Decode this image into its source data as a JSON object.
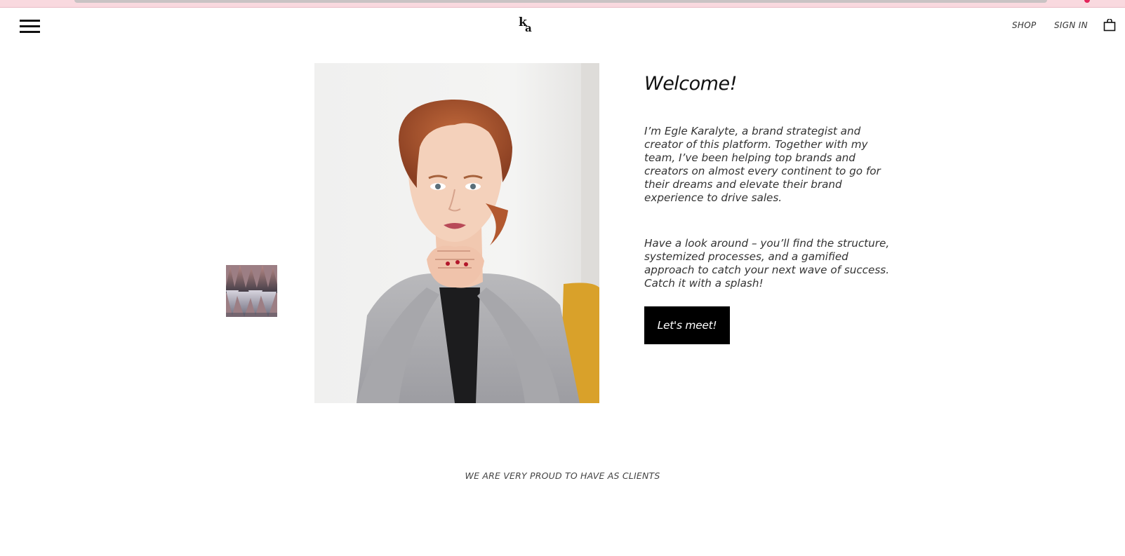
{
  "browser": {
    "accent_color": "#f9d9df"
  },
  "header": {
    "menu_icon": "hamburger-menu-icon",
    "logo_text": "ka",
    "nav": {
      "shop_label": "SHOP",
      "signin_label": "SIGN IN"
    },
    "cart_icon": "shopping-bag-icon"
  },
  "hero": {
    "thumbnail_icon": "gallery-thumbnail",
    "portrait_alt": "portrait photo",
    "title": "Welcome!",
    "paragraph_1": "I’m Egle Karalyte, a brand strategist and creator of this platform. Together with my team, I’ve been helping top brands and creators on almost every continent to go for their dreams and elevate their brand experience to drive sales.",
    "paragraph_2": "Have a look around – you’ll find the structure, systemized processes, and a gamified approach to catch your next wave of success. Catch it with a splash!",
    "cta_label": "Let's meet!"
  },
  "clients": {
    "heading": "WE ARE VERY PROUD TO HAVE AS CLIENTS"
  },
  "colors": {
    "text": "#222222",
    "button_bg": "#000000",
    "button_text": "#ffffff"
  }
}
